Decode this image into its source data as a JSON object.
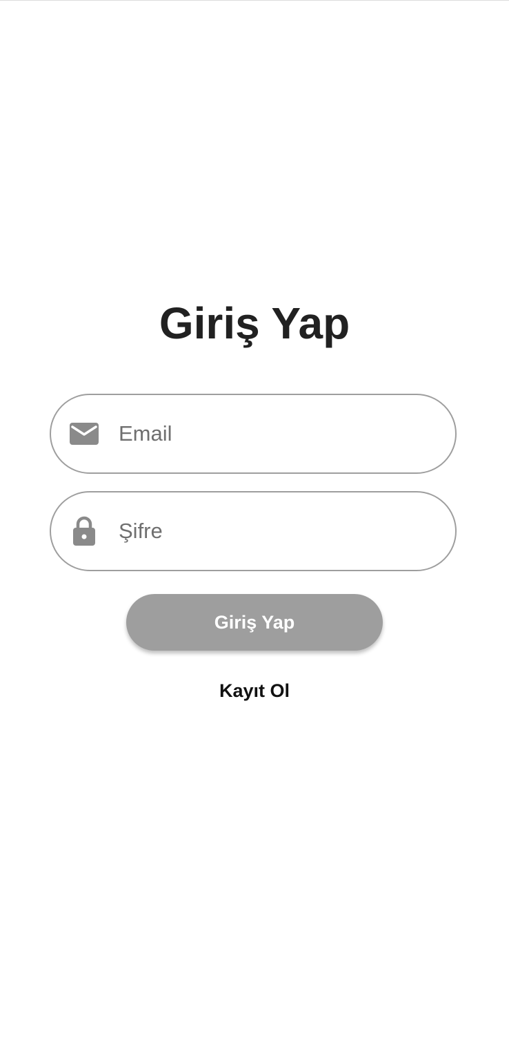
{
  "title": "Giriş Yap",
  "email_field": {
    "placeholder": "Email",
    "value": "",
    "icon": "mail-icon"
  },
  "password_field": {
    "placeholder": "Şifre",
    "value": "",
    "icon": "lock-icon"
  },
  "login_button": {
    "label": "Giriş Yap"
  },
  "register_link": {
    "label": "Kayıt Ol"
  },
  "colors": {
    "background": "#ffffff",
    "title": "#212121",
    "field_border": "#9e9e9e",
    "icon": "#8a8a8a",
    "placeholder": "#6f6f6f",
    "button_bg": "#9e9e9e",
    "button_text": "#ffffff",
    "link_text": "#111111"
  }
}
